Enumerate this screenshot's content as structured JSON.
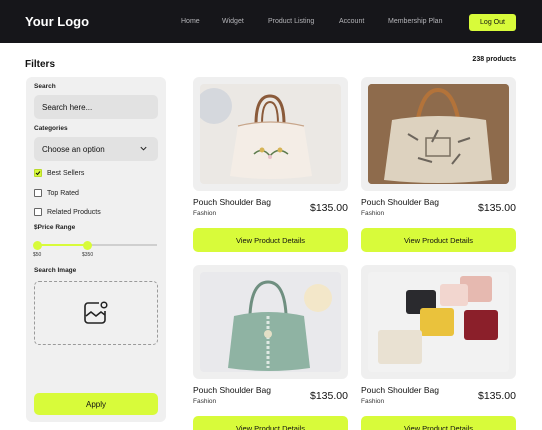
{
  "header": {
    "logo": "Your Logo",
    "nav": [
      "Home",
      "Widget",
      "Product Listing",
      "Account",
      "Membership Plan"
    ],
    "logout_label": "Log Out"
  },
  "filters": {
    "title": "Filters",
    "search_label": "Search",
    "search_placeholder": "Search here...",
    "categories_label": "Categories",
    "categories_value": "Choose an option",
    "checkboxes": [
      {
        "label": "Best Sellers",
        "checked": true
      },
      {
        "label": "Top Rated",
        "checked": false
      },
      {
        "label": "Related Products",
        "checked": false
      }
    ],
    "price_label": "$Price Range",
    "price_min": "$50",
    "price_max": "$350",
    "image_label": "Search Image",
    "apply_label": "Apply"
  },
  "product_count": "238 products",
  "products": [
    {
      "title": "Pouch Shoulder Bag",
      "category": "Fashion",
      "price": "$135.00",
      "button": "View Product Details"
    },
    {
      "title": "Pouch Shoulder Bag",
      "category": "Fashion",
      "price": "$135.00",
      "button": "View Product Details"
    },
    {
      "title": "Pouch Shoulder Bag",
      "category": "Fashion",
      "price": "$135.00",
      "button": "View Product Details"
    },
    {
      "title": "Pouch Shoulder Bag",
      "category": "Fashion",
      "price": "$135.00",
      "button": "View Product Details"
    }
  ],
  "colors": {
    "accent": "#d8fb3a",
    "header_bg": "#16161a",
    "panel_bg": "#f0f0f0"
  }
}
